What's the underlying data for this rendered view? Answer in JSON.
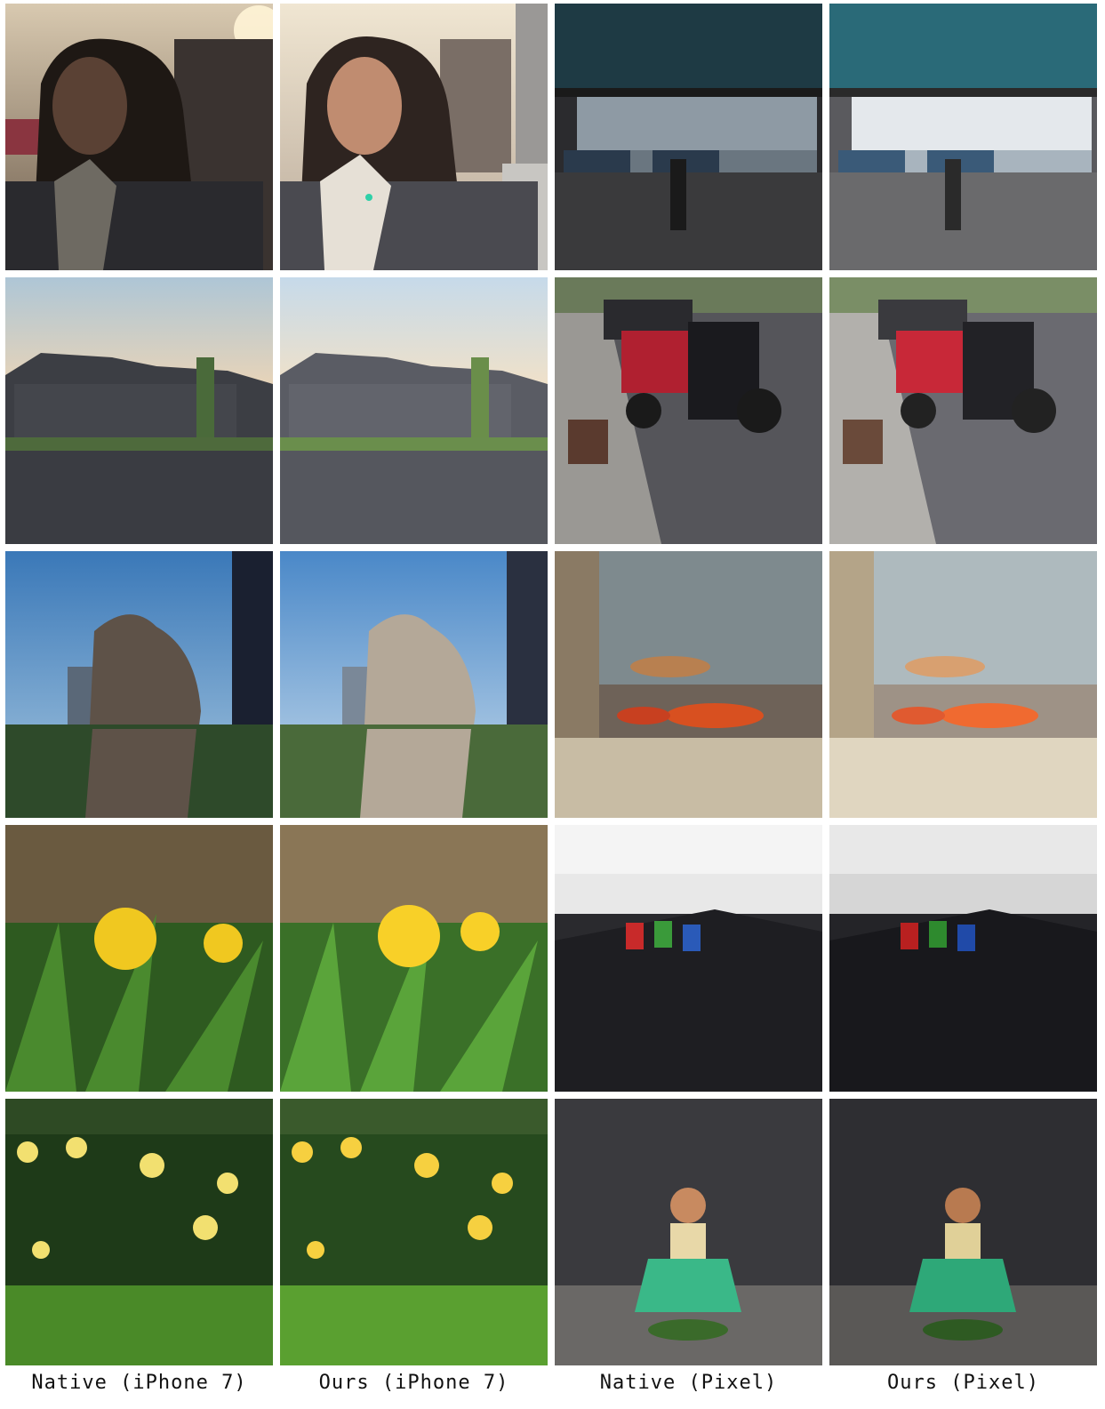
{
  "columns": [
    {
      "label": "Native (iPhone 7)"
    },
    {
      "label": "Ours (iPhone 7)"
    },
    {
      "label": "Native (Pixel)"
    },
    {
      "label": "Ours (Pixel)"
    }
  ],
  "rows": [
    {
      "left_scene": "portrait-woman-sunset",
      "right_scene": "kiosk-window-hall"
    },
    {
      "left_scene": "suburban-houses-street",
      "right_scene": "motorcycle-street"
    },
    {
      "left_scene": "engraved-rock-backlit",
      "right_scene": "koi-aquarium"
    },
    {
      "left_scene": "yellow-lily-flowers",
      "right_scene": "soda-cans-computers"
    },
    {
      "left_scene": "yellow-rose-bushes",
      "right_scene": "hula-doll-figurine"
    }
  ],
  "colors": {
    "background": "#ffffff",
    "label_text": "#111111"
  }
}
